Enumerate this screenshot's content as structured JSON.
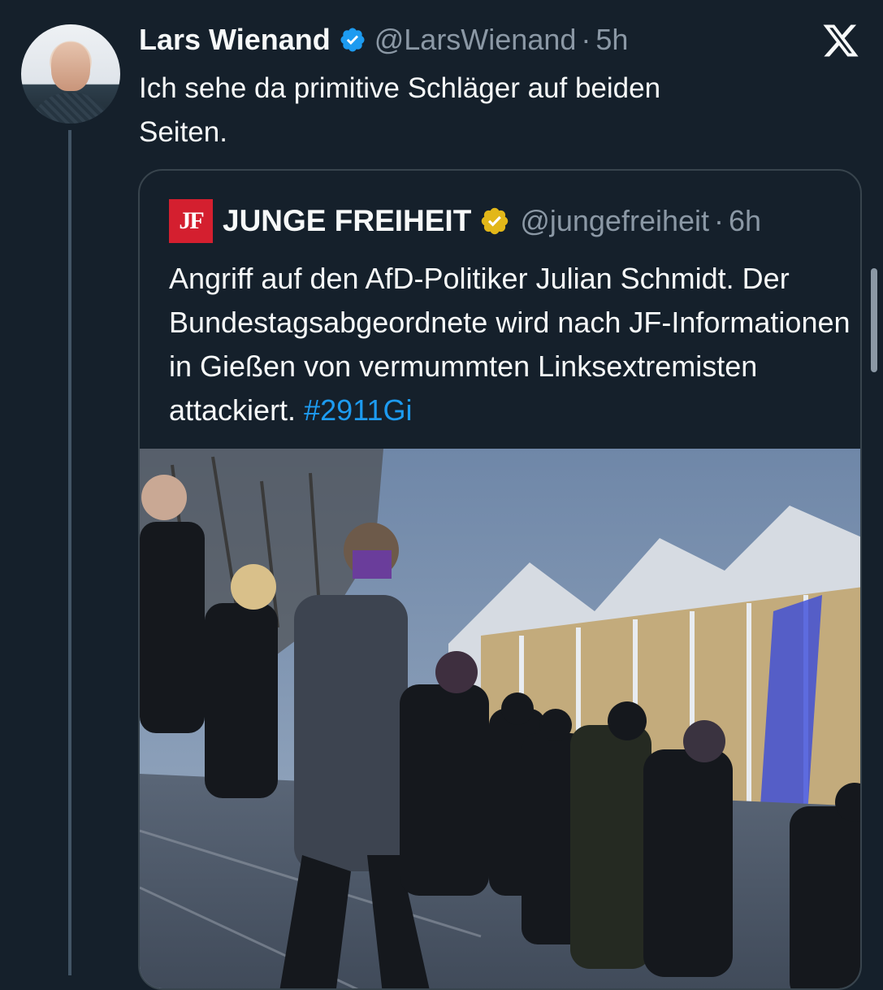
{
  "tweet": {
    "author_name": "Lars Wienand",
    "handle": "@LarsWienand",
    "separator": "·",
    "time": "5h",
    "text": "Ich sehe da primitive Schläger auf beiden\nSeiten."
  },
  "quoted": {
    "logo_text": "JF",
    "author_name": "JUNGE FREIHEIT",
    "handle": "@jungefreiheit",
    "separator": "·",
    "time": "6h",
    "text": "Angriff auf den AfD-Politiker Julian Schmidt. Der Bundestagsabgeordnete wird nach JF-Informationen in Gießen von vermummten Linksextremisten attackiert.",
    "hashtag": "#2911Gi"
  },
  "icons": {
    "verified": "blue-checkmark-icon",
    "org_verified": "gold-checkmark-icon",
    "platform": "x-logo-icon"
  },
  "colors": {
    "background": "#15202b",
    "text": "#f7f9f9",
    "muted": "#8b98a5",
    "link": "#1d9bf0",
    "verified_blue": "#1d9bf0",
    "verified_gold": "#e2b719",
    "jf_red": "#d41f2f"
  }
}
